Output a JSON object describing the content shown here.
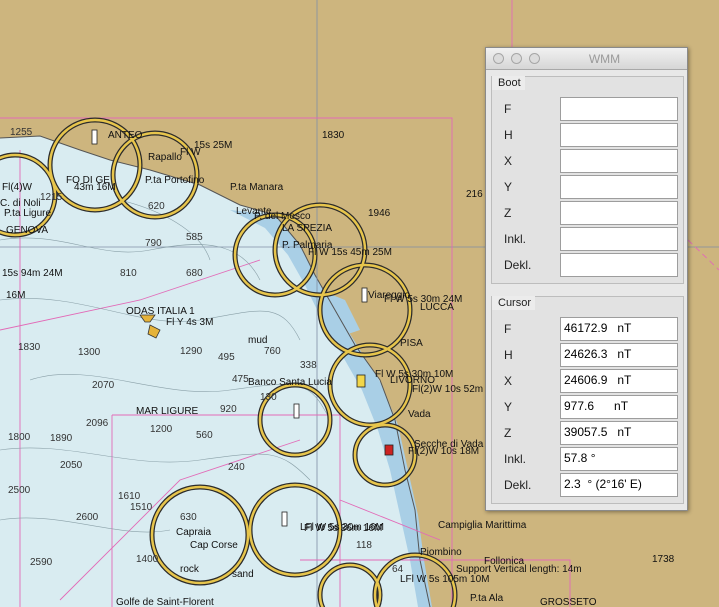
{
  "map": {
    "labels": [
      "ANTEO",
      "GENOVA",
      "FO DI GE",
      "Fl(4)W",
      "43m 16M",
      "Fl W",
      "15s 25M",
      "Rapallo",
      "P.ta Portofino",
      "P.ta Manara",
      "Levante",
      "C. di Noli",
      "P.ta Ligure",
      "15s 94m 24M",
      "16M",
      "P. del Mesco",
      "LA SPEZIA",
      "Fl W 15s 45m 25M",
      "P. Palmaria",
      "Viareggio",
      "Fl W 5s 30m 24M",
      "LUCCA",
      "PISA",
      "ODAS ITALIA 1",
      "Fl Y 4s 3M",
      "mud",
      "Banco Santa Lucia",
      "MAR LIGURE",
      "LIVORNO",
      "Fl(2)W 10s 52m 18M",
      "Fl W 5s 30m 10M",
      "Vada",
      "Secche di Vada",
      "Fl(2)W 10s 18M",
      "Capraia",
      "Fl W 5s 36m 16M",
      "Cap Corse",
      "LFl W 5s 30m 16M",
      "Campiglia Marittima",
      "Piombino",
      "Follonica",
      "Support Vertical length: 14m",
      "LFl W 5s 105m 10M",
      "GROSSETO",
      "P.ta Ala",
      "Golfe de Saint-Florent",
      "1830",
      "1946",
      "216",
      "1738",
      "sand",
      "rock"
    ],
    "depths": [
      "1255",
      "1215",
      "620",
      "790",
      "585",
      "810",
      "680",
      "1300",
      "1290",
      "2070",
      "1800",
      "1890",
      "2096",
      "2500",
      "2590",
      "1400",
      "1610",
      "630",
      "920",
      "495",
      "338",
      "760",
      "560",
      "240",
      "1200",
      "1830",
      "2050",
      "2600",
      "1510",
      "475",
      "130",
      "118",
      "64"
    ]
  },
  "window": {
    "title": "WMM",
    "boot": {
      "title": "Boot",
      "rows": [
        {
          "label": "F",
          "value": ""
        },
        {
          "label": "H",
          "value": ""
        },
        {
          "label": "X",
          "value": ""
        },
        {
          "label": "Y",
          "value": ""
        },
        {
          "label": "Z",
          "value": ""
        },
        {
          "label": "Inkl.",
          "value": ""
        },
        {
          "label": "Dekl.",
          "value": ""
        }
      ]
    },
    "cursor": {
      "title": "Cursor",
      "rows": [
        {
          "label": "F",
          "value": "46172.9   nT"
        },
        {
          "label": "H",
          "value": "24626.3   nT"
        },
        {
          "label": "X",
          "value": "24606.9   nT"
        },
        {
          "label": "Y",
          "value": "977.6      nT"
        },
        {
          "label": "Z",
          "value": "39057.5   nT"
        },
        {
          "label": "Inkl.",
          "value": "57.8 °"
        },
        {
          "label": "Dekl.",
          "value": "2.3  ° (2°16' E)"
        }
      ]
    }
  }
}
